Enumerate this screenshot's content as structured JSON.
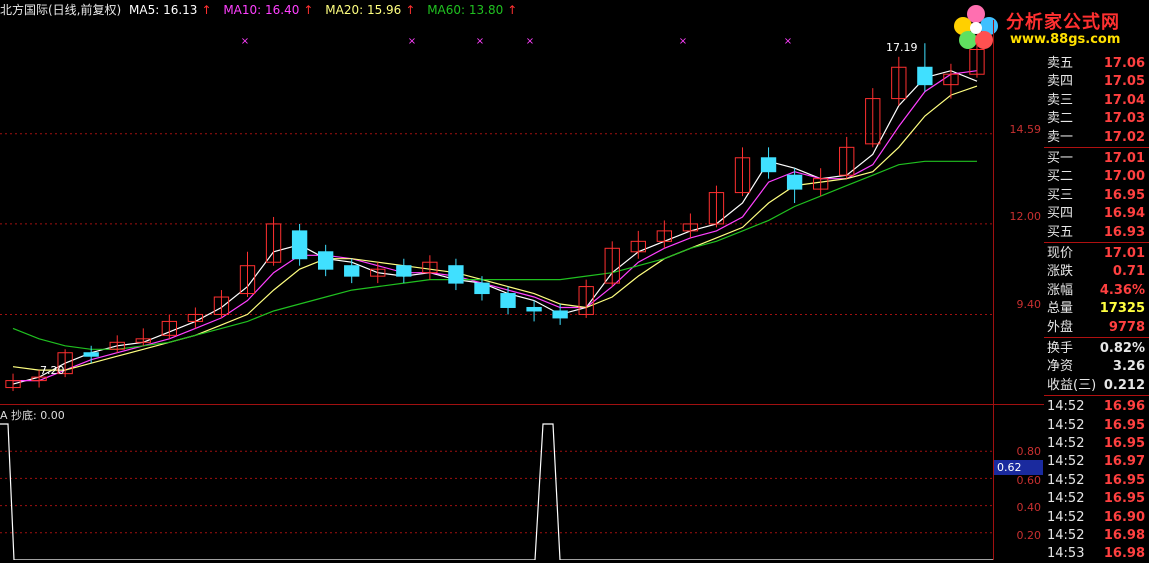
{
  "header": {
    "stock_title": "北方国际(日线,前复权)",
    "ma5": "MA5: 16.13",
    "ma10": "MA10: 16.40",
    "ma20": "MA20: 15.96",
    "ma60": "MA60: 13.80",
    "arrow": "↑"
  },
  "logo": {
    "name": "分析家公式网",
    "url": "www.88gs.com"
  },
  "colors": {
    "ma5": "#ffffff",
    "ma10": "#ff40ff",
    "ma20": "#ffff80",
    "ma60": "#20c020",
    "up": "#ff3030",
    "down": "#40e0ff",
    "grid": "#a01010"
  },
  "price_axis": {
    "ticks": [
      "14.59",
      "12.00",
      "9.40"
    ]
  },
  "indicator": {
    "name": "A 抄底: 0.00",
    "ticks": [
      "0.80",
      "0.60",
      "0.40",
      "0.20"
    ],
    "current": "0.62"
  },
  "annotations": {
    "high": "17.19",
    "low": "7.20"
  },
  "quote_panel": {
    "asks": [
      {
        "label": "卖五",
        "value": "17.06"
      },
      {
        "label": "卖四",
        "value": "17.05"
      },
      {
        "label": "卖三",
        "value": "17.04"
      },
      {
        "label": "卖二",
        "value": "17.03"
      },
      {
        "label": "卖一",
        "value": "17.02"
      }
    ],
    "bids": [
      {
        "label": "买一",
        "value": "17.01"
      },
      {
        "label": "买二",
        "value": "17.00"
      },
      {
        "label": "买三",
        "value": "16.95"
      },
      {
        "label": "买四",
        "value": "16.94"
      },
      {
        "label": "买五",
        "value": "16.93"
      }
    ],
    "stats": [
      {
        "label": "现价",
        "value": "17.01"
      },
      {
        "label": "涨跌",
        "value": "0.71"
      },
      {
        "label": "涨幅",
        "value": "4.36%"
      },
      {
        "label": "总量",
        "value": "17325"
      },
      {
        "label": "外盘",
        "value": "9778"
      }
    ],
    "stats2": [
      {
        "label": "换手",
        "value": "0.82%"
      },
      {
        "label": "净资",
        "value": "3.26"
      },
      {
        "label": "收益(三)",
        "value": "0.212"
      }
    ],
    "ticks": [
      {
        "time": "14:52",
        "price": "16.96"
      },
      {
        "time": "14:52",
        "price": "16.95"
      },
      {
        "time": "14:52",
        "price": "16.95"
      },
      {
        "time": "14:52",
        "price": "16.97"
      },
      {
        "time": "14:52",
        "price": "16.95"
      },
      {
        "time": "14:52",
        "price": "16.95"
      },
      {
        "time": "14:52",
        "price": "16.90"
      },
      {
        "time": "14:52",
        "price": "16.98"
      },
      {
        "time": "14:53",
        "price": "16.98"
      }
    ]
  },
  "chart_data": {
    "type": "line",
    "title": "北方国际(日线,前复权)",
    "ylim": [
      7.0,
      17.8
    ],
    "series": [
      {
        "name": "MA5",
        "values": [
          7.4,
          7.6,
          8.0,
          8.3,
          8.5,
          8.6,
          8.9,
          9.2,
          9.6,
          10.2,
          11.2,
          11.4,
          11.0,
          10.9,
          10.6,
          10.5,
          10.6,
          10.4,
          10.3,
          10.0,
          9.8,
          9.4,
          9.6,
          10.6,
          11.2,
          11.5,
          11.8,
          12.0,
          12.6,
          13.8,
          13.6,
          13.3,
          13.4,
          14.0,
          15.4,
          16.2,
          16.4,
          16.1
        ]
      },
      {
        "name": "MA10",
        "values": [
          7.5,
          7.5,
          7.8,
          8.1,
          8.3,
          8.5,
          8.7,
          9.0,
          9.3,
          9.8,
          10.6,
          11.1,
          11.1,
          11.0,
          10.8,
          10.6,
          10.6,
          10.5,
          10.3,
          10.1,
          9.9,
          9.6,
          9.6,
          10.2,
          10.9,
          11.3,
          11.6,
          11.8,
          12.2,
          13.2,
          13.5,
          13.3,
          13.3,
          13.7,
          14.8,
          15.8,
          16.3,
          16.4
        ]
      },
      {
        "name": "MA20",
        "values": [
          7.9,
          7.8,
          7.8,
          8.0,
          8.2,
          8.4,
          8.6,
          8.8,
          9.1,
          9.4,
          10.1,
          10.7,
          11.0,
          11.0,
          10.9,
          10.8,
          10.7,
          10.6,
          10.4,
          10.2,
          10.0,
          9.7,
          9.6,
          9.9,
          10.5,
          11.0,
          11.3,
          11.6,
          11.9,
          12.6,
          13.1,
          13.2,
          13.3,
          13.5,
          14.2,
          15.1,
          15.7,
          15.96
        ]
      },
      {
        "name": "MA60",
        "values": [
          9.0,
          8.7,
          8.5,
          8.4,
          8.4,
          8.5,
          8.6,
          8.8,
          9.0,
          9.2,
          9.5,
          9.7,
          9.9,
          10.1,
          10.2,
          10.3,
          10.4,
          10.4,
          10.4,
          10.4,
          10.4,
          10.4,
          10.5,
          10.6,
          10.8,
          11.0,
          11.3,
          11.5,
          11.8,
          12.1,
          12.5,
          12.8,
          13.1,
          13.4,
          13.7,
          13.8,
          13.8,
          13.8
        ]
      }
    ],
    "candles": [
      {
        "o": 7.3,
        "c": 7.5,
        "h": 7.7,
        "l": 7.2
      },
      {
        "o": 7.5,
        "c": 7.6,
        "h": 7.8,
        "l": 7.3
      },
      {
        "o": 7.7,
        "c": 8.3,
        "h": 8.4,
        "l": 7.6
      },
      {
        "o": 8.3,
        "c": 8.2,
        "h": 8.5,
        "l": 8.0
      },
      {
        "o": 8.4,
        "c": 8.6,
        "h": 8.8,
        "l": 8.3
      },
      {
        "o": 8.6,
        "c": 8.7,
        "h": 9.0,
        "l": 8.5
      },
      {
        "o": 8.8,
        "c": 9.2,
        "h": 9.4,
        "l": 8.7
      },
      {
        "o": 9.2,
        "c": 9.4,
        "h": 9.6,
        "l": 9.0
      },
      {
        "o": 9.4,
        "c": 9.9,
        "h": 10.1,
        "l": 9.3
      },
      {
        "o": 10.0,
        "c": 10.8,
        "h": 11.2,
        "l": 9.9
      },
      {
        "o": 10.9,
        "c": 12.0,
        "h": 12.2,
        "l": 10.8
      },
      {
        "o": 11.8,
        "c": 11.0,
        "h": 12.0,
        "l": 10.8
      },
      {
        "o": 11.2,
        "c": 10.7,
        "h": 11.4,
        "l": 10.5
      },
      {
        "o": 10.8,
        "c": 10.5,
        "h": 11.0,
        "l": 10.3
      },
      {
        "o": 10.5,
        "c": 10.7,
        "h": 10.9,
        "l": 10.3
      },
      {
        "o": 10.8,
        "c": 10.5,
        "h": 11.0,
        "l": 10.3
      },
      {
        "o": 10.6,
        "c": 10.9,
        "h": 11.1,
        "l": 10.4
      },
      {
        "o": 10.8,
        "c": 10.3,
        "h": 11.0,
        "l": 10.1
      },
      {
        "o": 10.3,
        "c": 10.0,
        "h": 10.5,
        "l": 9.8
      },
      {
        "o": 10.0,
        "c": 9.6,
        "h": 10.2,
        "l": 9.4
      },
      {
        "o": 9.6,
        "c": 9.5,
        "h": 9.8,
        "l": 9.2
      },
      {
        "o": 9.5,
        "c": 9.3,
        "h": 9.7,
        "l": 9.1
      },
      {
        "o": 9.4,
        "c": 10.2,
        "h": 10.4,
        "l": 9.3
      },
      {
        "o": 10.3,
        "c": 11.3,
        "h": 11.5,
        "l": 10.2
      },
      {
        "o": 11.2,
        "c": 11.5,
        "h": 11.8,
        "l": 11.0
      },
      {
        "o": 11.5,
        "c": 11.8,
        "h": 12.1,
        "l": 11.3
      },
      {
        "o": 11.8,
        "c": 12.0,
        "h": 12.3,
        "l": 11.6
      },
      {
        "o": 12.0,
        "c": 12.9,
        "h": 13.1,
        "l": 11.9
      },
      {
        "o": 12.9,
        "c": 13.9,
        "h": 14.2,
        "l": 12.8
      },
      {
        "o": 13.9,
        "c": 13.5,
        "h": 14.2,
        "l": 13.3
      },
      {
        "o": 13.4,
        "c": 13.0,
        "h": 13.6,
        "l": 12.6
      },
      {
        "o": 13.0,
        "c": 13.3,
        "h": 13.6,
        "l": 12.8
      },
      {
        "o": 13.4,
        "c": 14.2,
        "h": 14.5,
        "l": 13.3
      },
      {
        "o": 14.3,
        "c": 15.6,
        "h": 15.9,
        "l": 14.2
      },
      {
        "o": 15.6,
        "c": 16.5,
        "h": 16.8,
        "l": 15.4
      },
      {
        "o": 16.5,
        "c": 16.0,
        "h": 17.19,
        "l": 15.8
      },
      {
        "o": 16.0,
        "c": 16.3,
        "h": 16.6,
        "l": 15.6
      },
      {
        "o": 16.3,
        "c": 17.01,
        "h": 17.2,
        "l": 16.2
      }
    ],
    "indicator_series": {
      "name": "抄底",
      "peaks": [
        0,
        20
      ]
    }
  }
}
